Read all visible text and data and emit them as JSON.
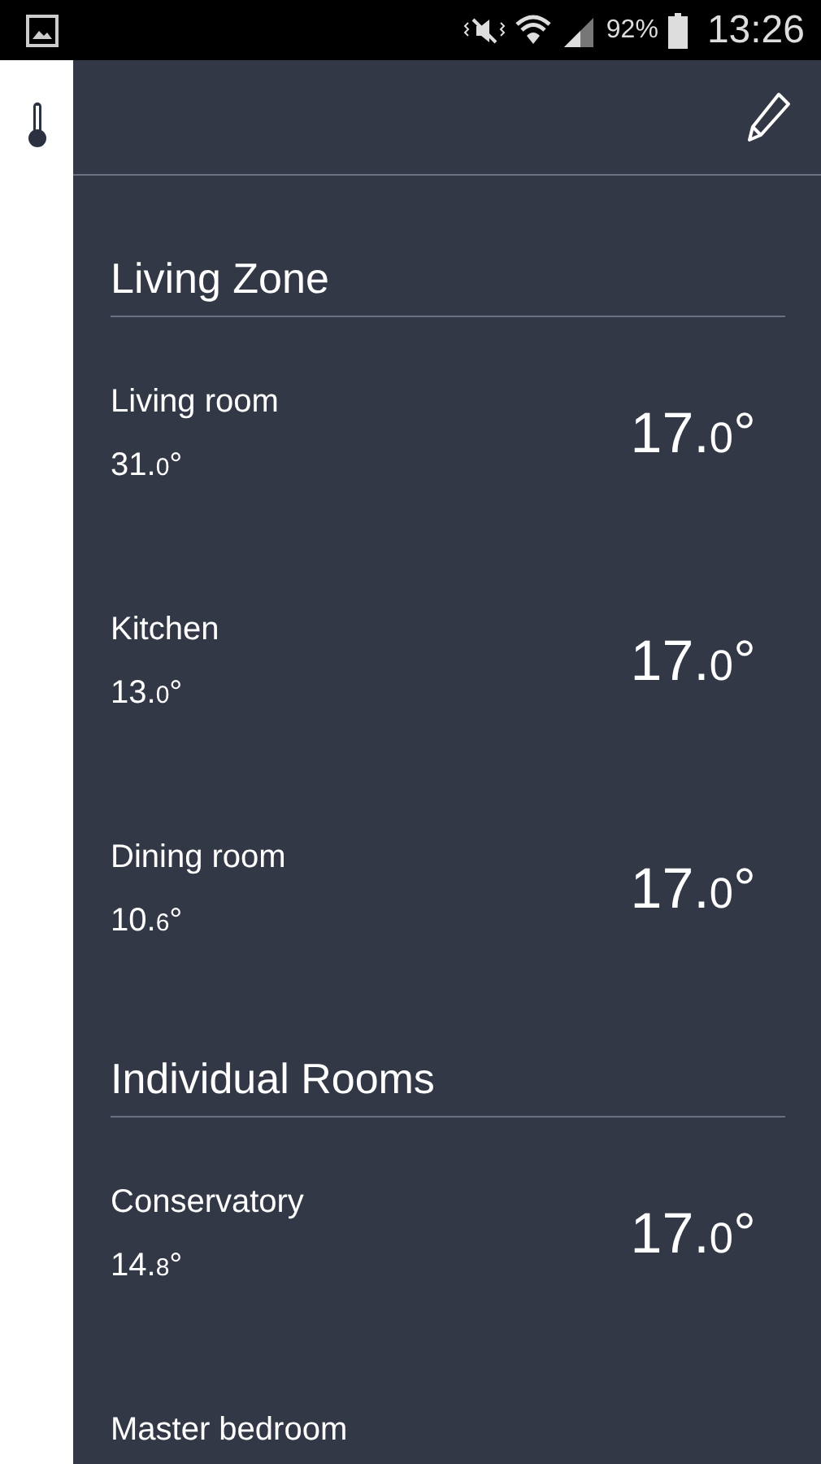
{
  "status_bar": {
    "battery": "92%",
    "time": "13:26"
  },
  "sections": [
    {
      "title": "Living Zone",
      "rooms": [
        {
          "name": "Living room",
          "current": {
            "whole": "31.",
            "decimal": "0",
            "unit": "°"
          },
          "setpoint": {
            "whole": "17.",
            "decimal": "0",
            "unit": "°"
          }
        },
        {
          "name": "Kitchen",
          "current": {
            "whole": "13.",
            "decimal": "0",
            "unit": "°"
          },
          "setpoint": {
            "whole": "17.",
            "decimal": "0",
            "unit": "°"
          }
        },
        {
          "name": "Dining room",
          "current": {
            "whole": "10.",
            "decimal": "6",
            "unit": "°"
          },
          "setpoint": {
            "whole": "17.",
            "decimal": "0",
            "unit": "°"
          }
        }
      ]
    },
    {
      "title": "Individual Rooms",
      "rooms": [
        {
          "name": "Conservatory",
          "current": {
            "whole": "14.",
            "decimal": "8",
            "unit": "°"
          },
          "setpoint": {
            "whole": "17.",
            "decimal": "0",
            "unit": "°"
          }
        },
        {
          "name": "Master bedroom"
        }
      ]
    }
  ]
}
